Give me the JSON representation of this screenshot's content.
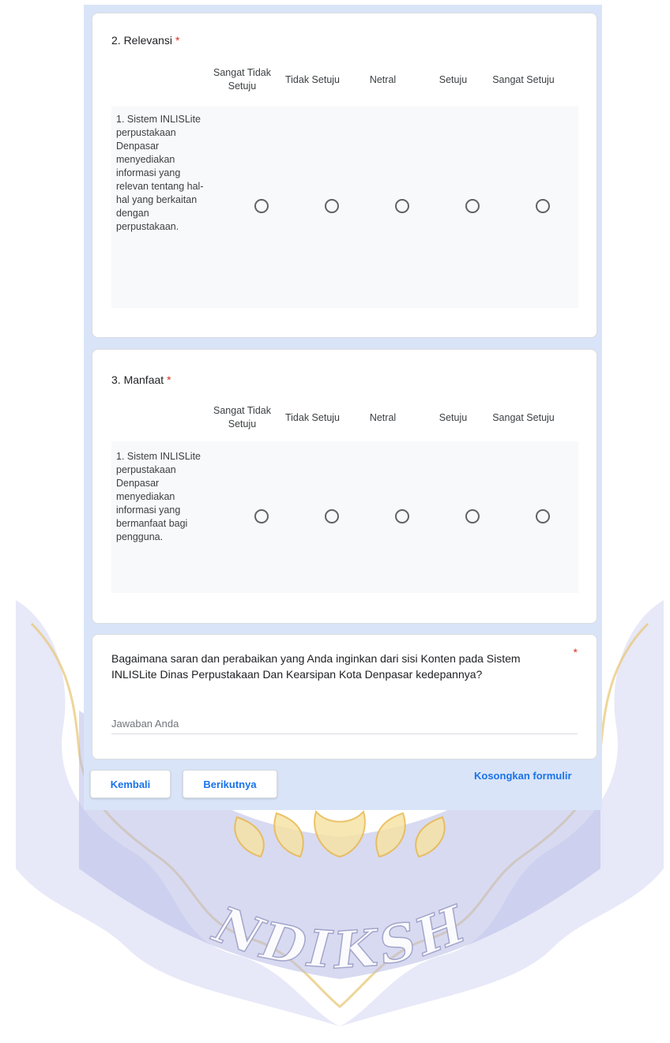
{
  "questions": [
    {
      "title": "2. Relevansi",
      "required_mark": "*",
      "columns": [
        "Sangat Tidak Setuju",
        "Tidak Setuju",
        "Netral",
        "Setuju",
        "Sangat Setuju"
      ],
      "row_label": "1. Sistem INLISLite perpustakaan Denpasar menyediakan informasi yang relevan tentang hal-hal yang berkaitan dengan perpustakaan."
    },
    {
      "title": "3. Manfaat",
      "required_mark": "*",
      "columns": [
        "Sangat Tidak Setuju",
        "Tidak Setuju",
        "Netral",
        "Setuju",
        "Sangat Setuju"
      ],
      "row_label": "1. Sistem INLISLite perpustakaan Denpasar menyediakan informasi yang bermanfaat bagi pengguna."
    }
  ],
  "open_question": {
    "text": "Bagaimana saran dan perabaikan yang Anda inginkan dari sisi Konten pada Sistem INLISLite Dinas Perpustakaan Dan Kearsipan Kota Denpasar kedepannya?",
    "required_mark": "*",
    "placeholder": "Jawaban Anda",
    "value": ""
  },
  "footer": {
    "back_label": "Kembali",
    "next_label": "Berikutnya",
    "clear_label": "Kosongkan formulir"
  },
  "watermark": {
    "text": "UNDIKSHA"
  },
  "colors": {
    "accent": "#1a73e8",
    "required": "#d93025",
    "form_background": "#d9e4f8",
    "watermark_blue": "#b6b8e8",
    "watermark_gold": "#f2c86a"
  }
}
